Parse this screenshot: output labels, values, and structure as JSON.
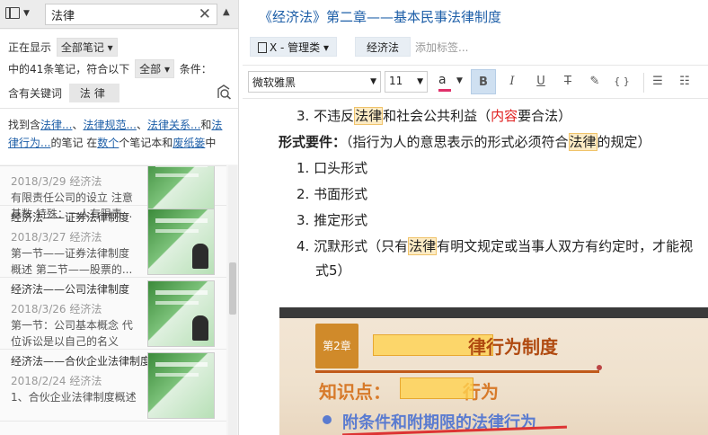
{
  "search": {
    "value": "法律"
  },
  "filter": {
    "showing_label": "正在显示",
    "showing_value": "全部笔记",
    "count_text": "中的41条笔记，符合以下",
    "match_value": "全部",
    "condition_label": "条件：",
    "keyword_label": "含有关键词",
    "keyword_value": "法律"
  },
  "result": {
    "prefix": "找到含",
    "links": [
      "法律...",
      "法律规范...",
      "法律关系...",
      "法律行为..."
    ],
    "and": "和",
    "de": "的笔记 在",
    "count_link": "数个",
    "mid": "个笔记本和",
    "trash_link": "废纸篓",
    "suffix": "中"
  },
  "notes": [
    {
      "title": "",
      "date": "2018/3/29   经济法",
      "snippet": "有限责任公司的设立 注意基数 特殊：一人有限责..."
    },
    {
      "title": "经济法——证券法律制度",
      "date": "2018/3/27   经济法",
      "snippet": "第一节——证券法律制度概述 第二节——股票的..."
    },
    {
      "title": "经济法——公司法律制度",
      "date": "2018/3/26   经济法",
      "snippet": "第一节：公司基本概念 代位诉讼是以自己的名义为..."
    },
    {
      "title": "经济法——合伙企业法律制度",
      "date": "2018/2/24   经济法",
      "snippet": "1、合伙企业法律制度概述"
    }
  ],
  "editor": {
    "title": "《经济法》第二章——基本民事法律制度",
    "notebook": "X - 管理类",
    "tag": "经济法",
    "add_tag": "添加标签...",
    "font": "微软雅黑",
    "size": "11"
  },
  "doc": {
    "l1_pre": "3. 不违反",
    "l1_hl": "法律",
    "l1_mid": "和社会公共利益（",
    "l1_red": "内容",
    "l1_post": "要合法）",
    "l2_b": "形式要件：",
    "l2_pre": "（指行为人的意思表示的形式必须符合",
    "l2_hl": "法律",
    "l2_post": "的规定）",
    "l3": "1. 口头形式",
    "l4": "2. 书面形式",
    "l5": "3. 推定形式",
    "l6_pre": "4. 沉默形式（只有",
    "l6_hl": "法律",
    "l6_post": "有明文规定或当事人双方有约定时，才能视",
    "l7": "式5）"
  },
  "photo": {
    "chapter": "第2章",
    "title_tail": "律行为制度",
    "kp": "知识点：",
    "kp_tail": "行为",
    "bullet": "附条件和附期限的法律行为"
  }
}
